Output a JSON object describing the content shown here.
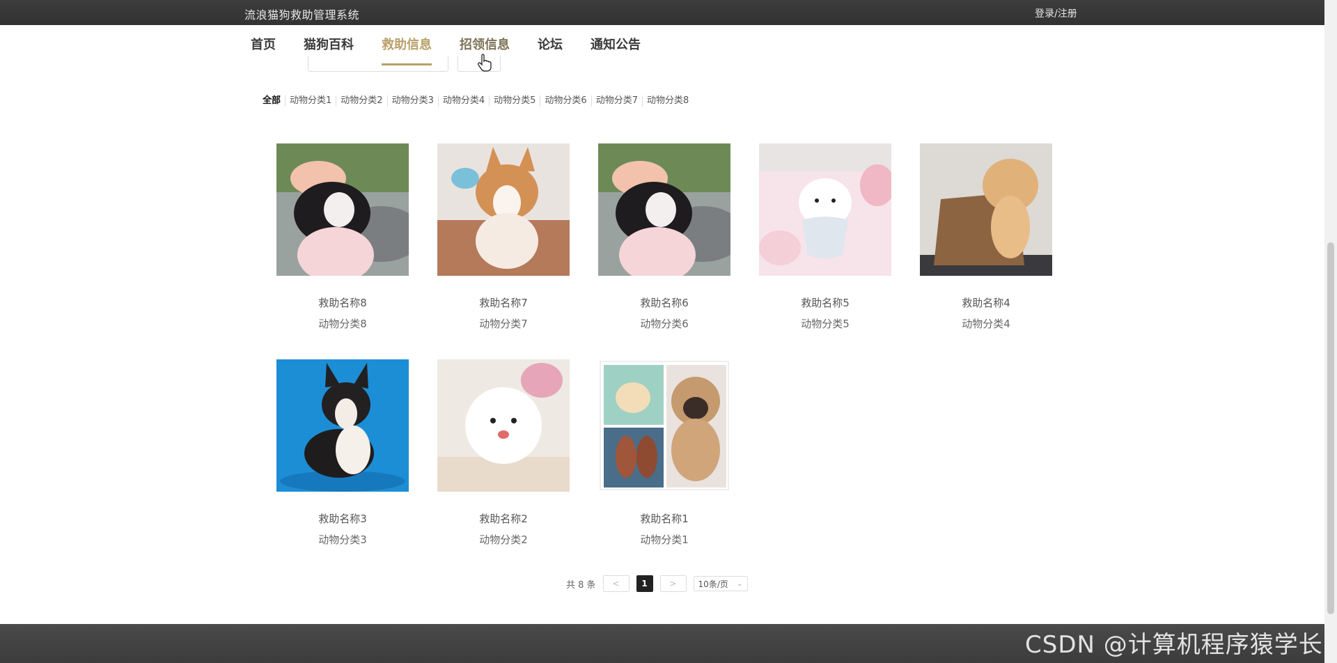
{
  "header": {
    "title": "流浪猫狗救助管理系统",
    "login": "登录/注册"
  },
  "nav": {
    "items": [
      {
        "label": "首页"
      },
      {
        "label": "猫狗百科"
      },
      {
        "label": "救助信息"
      },
      {
        "label": "招领信息"
      },
      {
        "label": "论坛"
      },
      {
        "label": "通知公告"
      }
    ]
  },
  "categories": [
    "全部",
    "动物分类1",
    "动物分类2",
    "动物分类3",
    "动物分类4",
    "动物分类5",
    "动物分类6",
    "动物分类7",
    "动物分类8"
  ],
  "cards": [
    {
      "name": "救助名称8",
      "category": "动物分类8"
    },
    {
      "name": "救助名称7",
      "category": "动物分类7"
    },
    {
      "name": "救助名称6",
      "category": "动物分类6"
    },
    {
      "name": "救助名称5",
      "category": "动物分类5"
    },
    {
      "name": "救助名称4",
      "category": "动物分类4"
    },
    {
      "name": "救助名称3",
      "category": "动物分类3"
    },
    {
      "name": "救助名称2",
      "category": "动物分类2"
    },
    {
      "name": "救助名称1",
      "category": "动物分类1"
    }
  ],
  "pagination": {
    "total": "共 8 条",
    "prev": "<",
    "page": "1",
    "next": ">",
    "size": "10条/页"
  },
  "watermark": "CSDN @计算机程序猿学长",
  "colors": {
    "accent": "#b9a06a",
    "topbar": "#353535",
    "footer": "#444444"
  }
}
